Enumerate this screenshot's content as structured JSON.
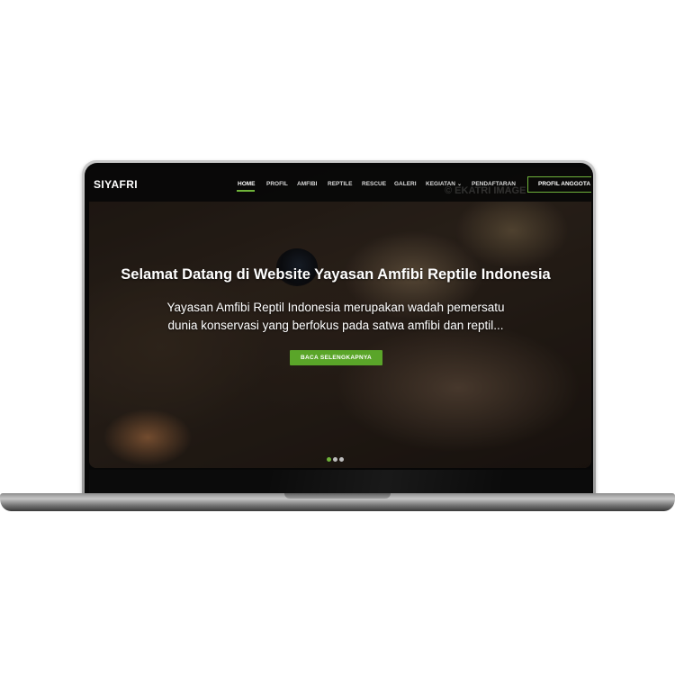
{
  "site": {
    "brand": "SIYAFRI",
    "nav": [
      {
        "label": "HOME",
        "active": true
      },
      {
        "label": "PROFIL"
      },
      {
        "label": "AMFIBI"
      },
      {
        "label": "REPTILE"
      },
      {
        "label": "RESCUE"
      },
      {
        "label": "GALERI"
      },
      {
        "label": "KEGIATAN",
        "dropdown": true
      },
      {
        "label": "PENDAFTARAN"
      }
    ],
    "profil_button": "PROFIL ANGGOTA",
    "watermark": "© EKATRI IMAGE"
  },
  "hero": {
    "title": "Selamat Datang di Website Yayasan Amfibi Reptile Indonesia",
    "desc_line1": "Yayasan Amfibi Reptil Indonesia merupakan wadah pemersatu",
    "desc_line2": "dunia konservasi yang berfokus pada satwa amfibi dan reptil...",
    "cta_label": "BACA SELENGKAPNYA"
  },
  "carousel": {
    "slide_count": 3,
    "active_slide": 1
  },
  "colors": {
    "accent": "#5aa529",
    "navbar": "#080808",
    "text": "#ffffff"
  },
  "icons": {
    "dropdown": "chevron-down-icon"
  }
}
